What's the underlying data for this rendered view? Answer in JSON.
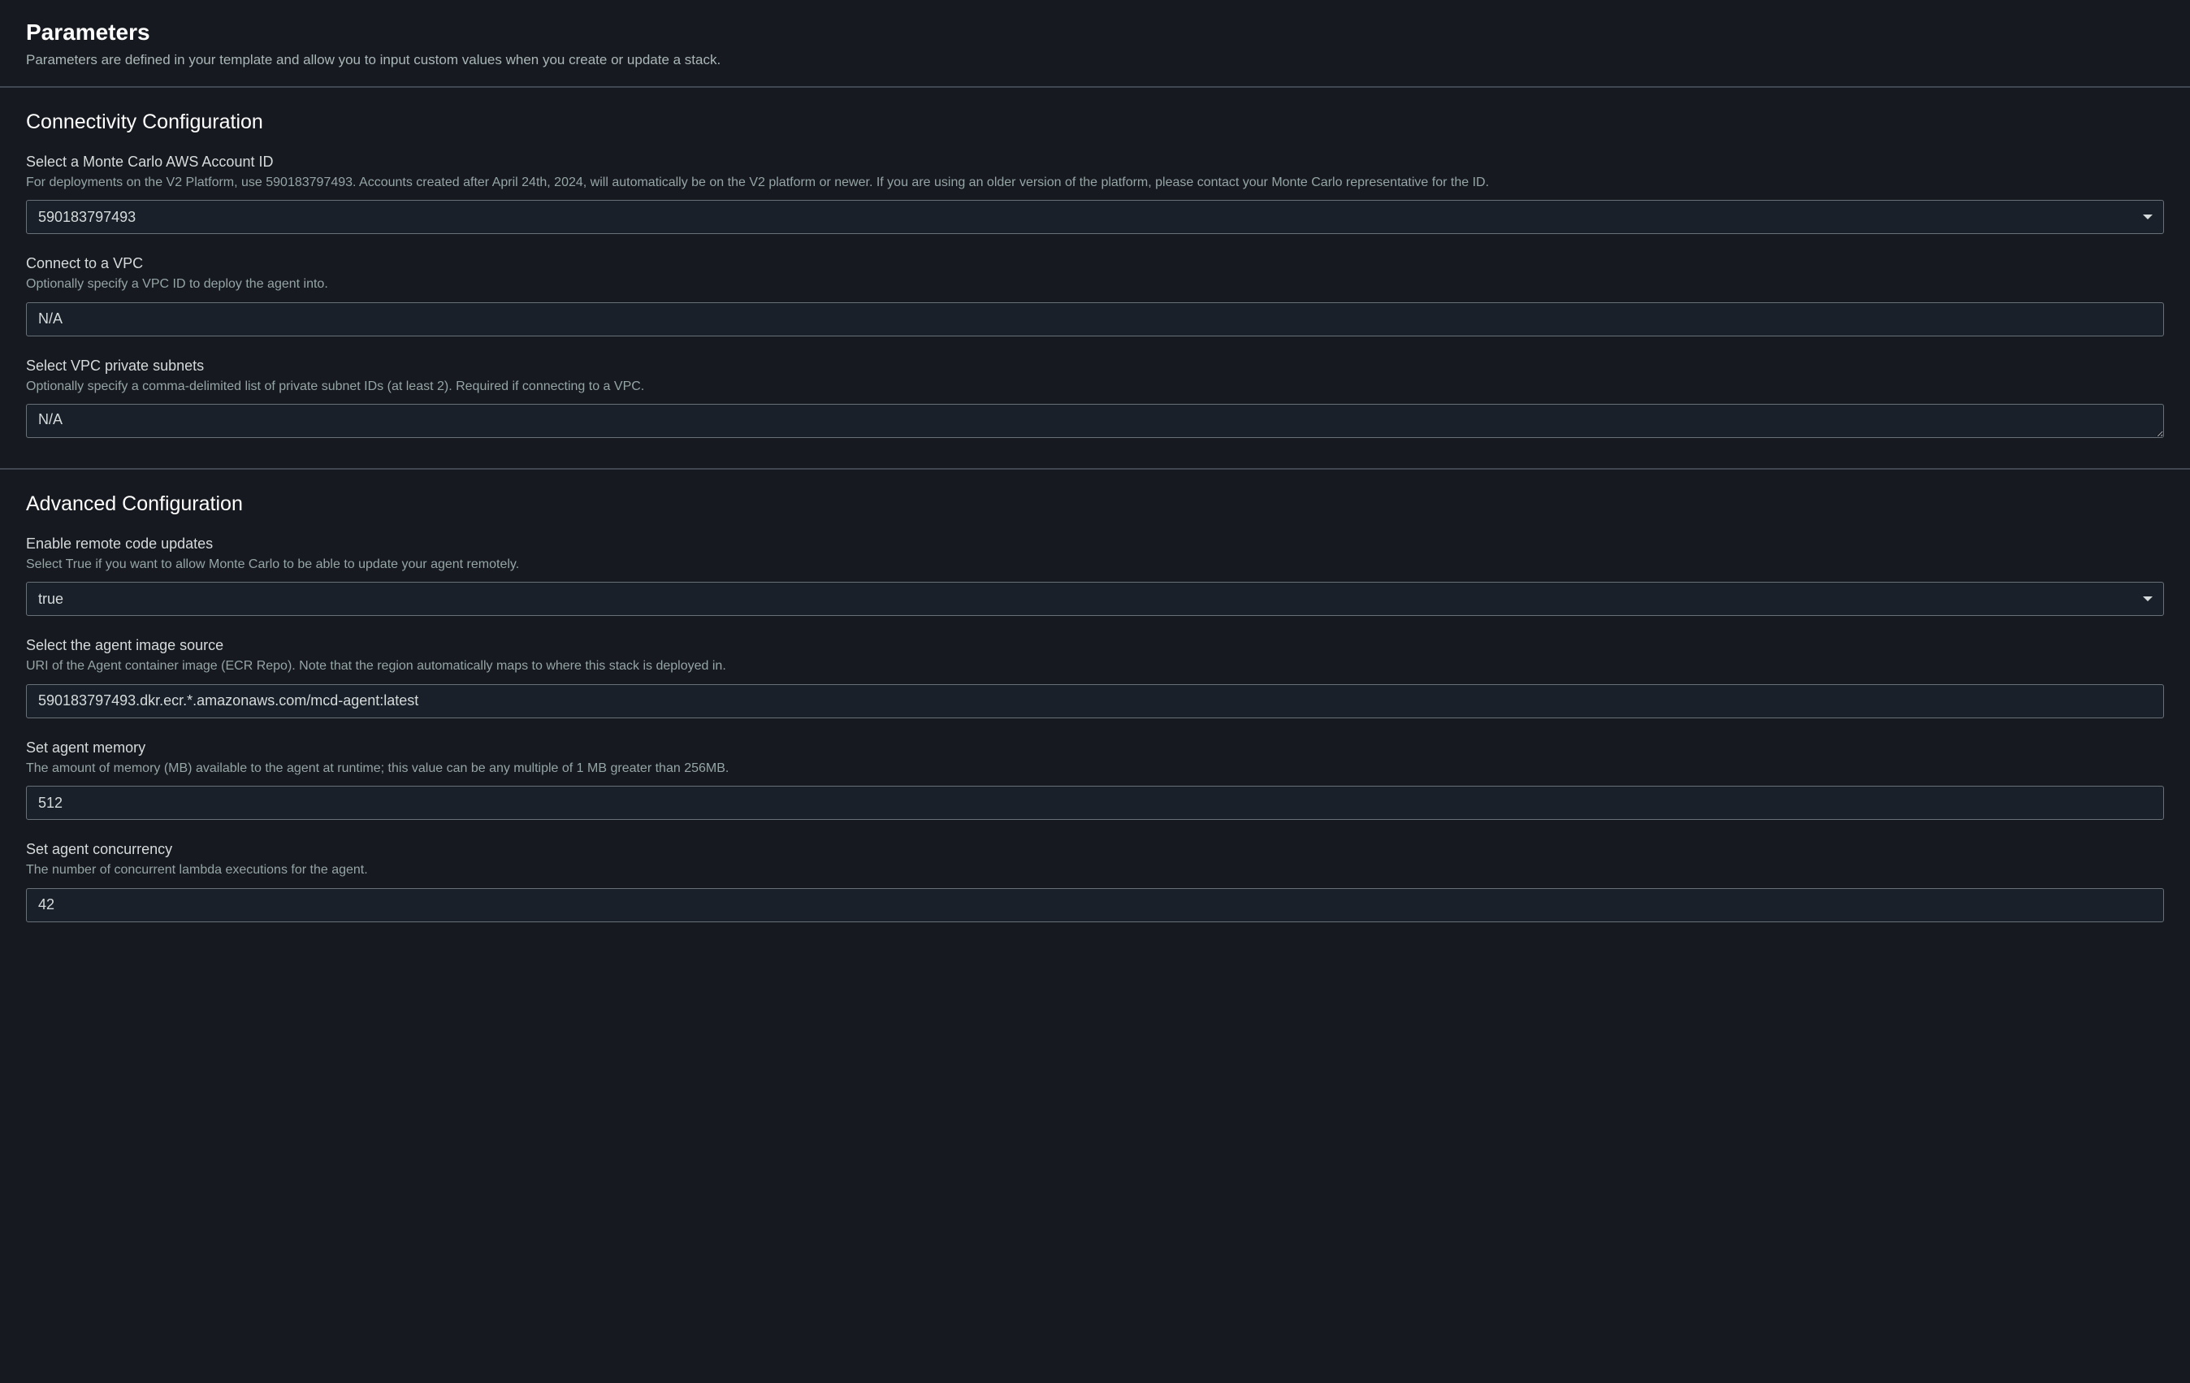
{
  "header": {
    "title": "Parameters",
    "description": "Parameters are defined in your template and allow you to input custom values when you create or update a stack."
  },
  "sections": {
    "connectivity": {
      "title": "Connectivity Configuration",
      "fields": {
        "account_id": {
          "label": "Select a Monte Carlo AWS Account ID",
          "description": "For deployments on the V2 Platform, use 590183797493. Accounts created after April 24th, 2024, will automatically be on the V2 platform or newer. If you are using an older version of the platform, please contact your Monte Carlo representative for the ID.",
          "value": "590183797493"
        },
        "vpc": {
          "label": "Connect to a VPC",
          "description": "Optionally specify a VPC ID to deploy the agent into.",
          "value": "N/A"
        },
        "subnets": {
          "label": "Select VPC private subnets",
          "description": "Optionally specify a comma-delimited list of private subnet IDs (at least 2). Required if connecting to a VPC.",
          "value": "N/A"
        }
      }
    },
    "advanced": {
      "title": "Advanced Configuration",
      "fields": {
        "remote_updates": {
          "label": "Enable remote code updates",
          "description": "Select True if you want to allow Monte Carlo to be able to update your agent remotely.",
          "value": "true"
        },
        "image_source": {
          "label": "Select the agent image source",
          "description": "URI of the Agent container image (ECR Repo). Note that the region automatically maps to where this stack is deployed in.",
          "value": "590183797493.dkr.ecr.*.amazonaws.com/mcd-agent:latest"
        },
        "memory": {
          "label": "Set agent memory",
          "description": "The amount of memory (MB) available to the agent at runtime; this value can be any multiple of 1 MB greater than 256MB.",
          "value": "512"
        },
        "concurrency": {
          "label": "Set agent concurrency",
          "description": "The number of concurrent lambda executions for the agent.",
          "value": "42"
        }
      }
    }
  }
}
